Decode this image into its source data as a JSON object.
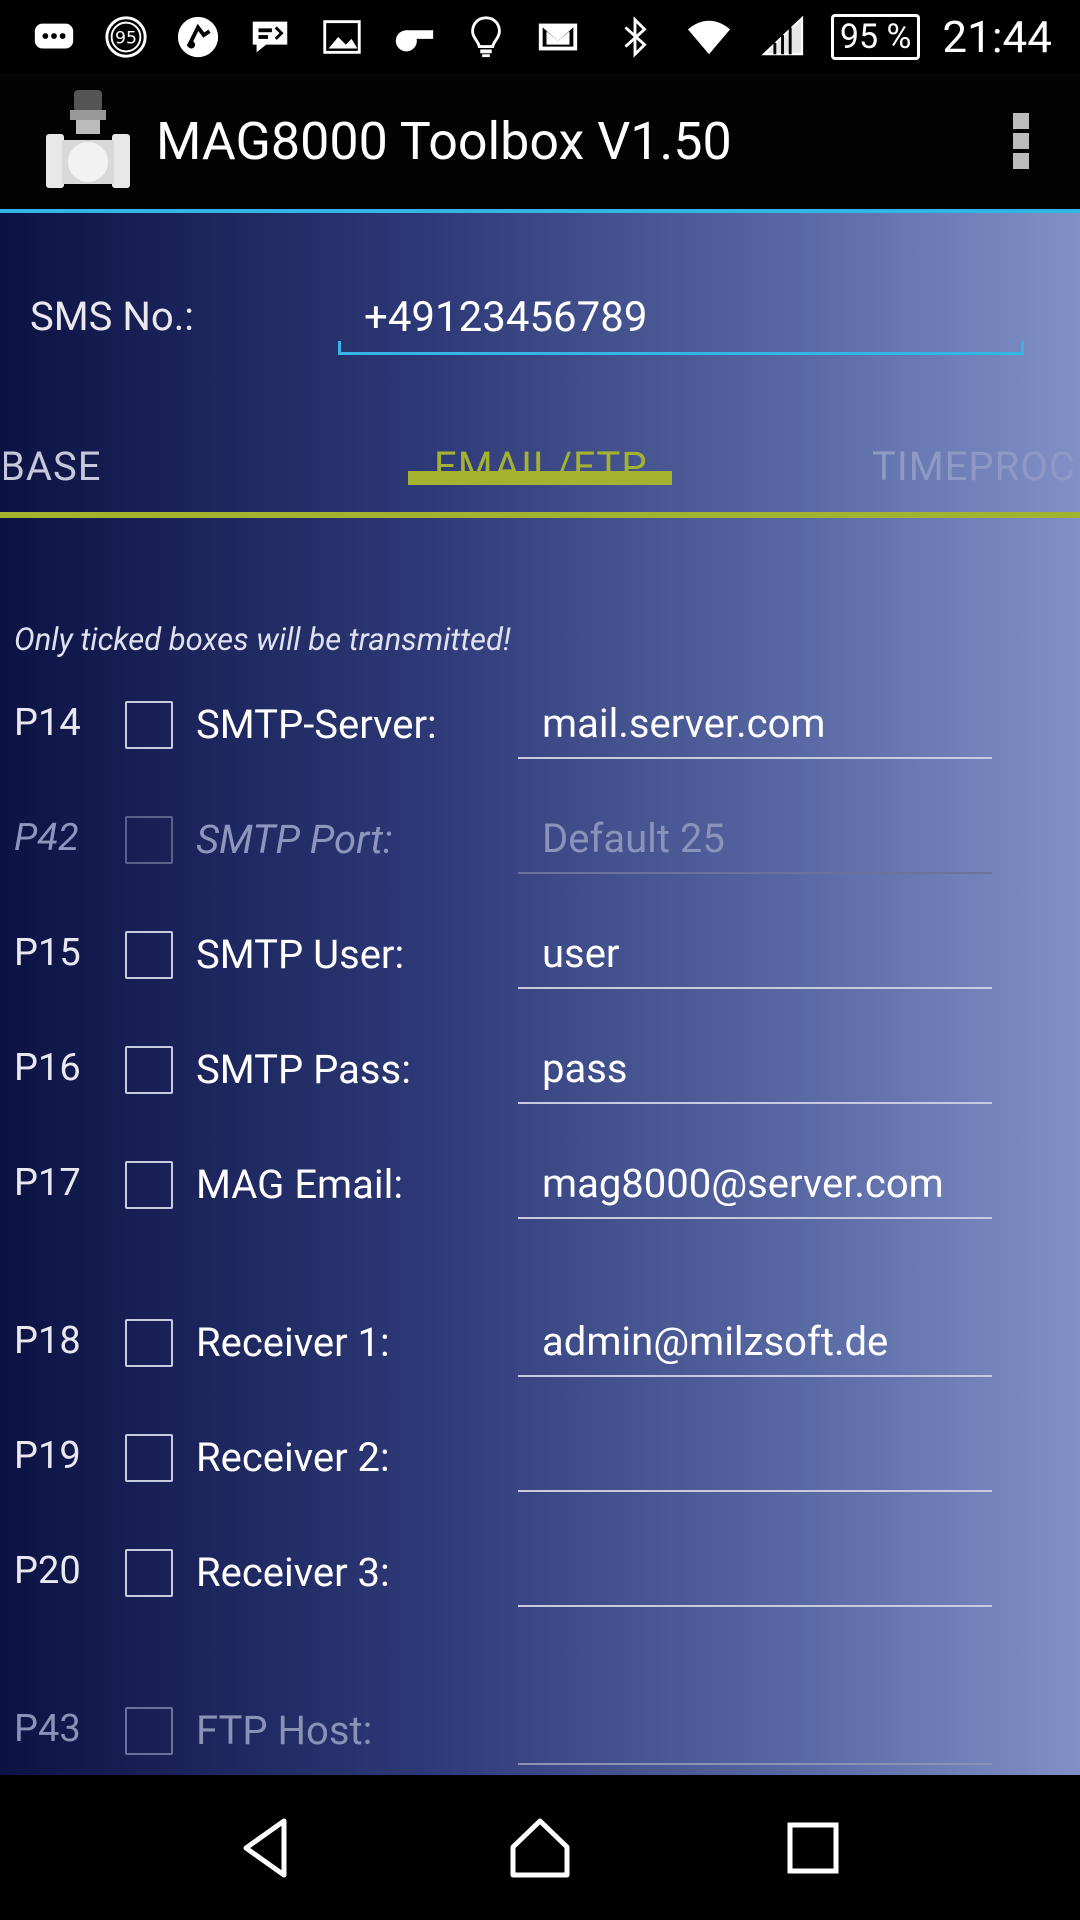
{
  "status_bar": {
    "notification_icons": [
      "messaging-icon",
      "speed-limit-icon",
      "app-icon",
      "chat-icon",
      "gallery-icon",
      "whistle-icon",
      "lightbulb-icon",
      "gmail-icon"
    ],
    "system_icons": [
      "bluetooth-icon",
      "wifi-icon",
      "cell-signal-icon"
    ],
    "battery": "95 %",
    "badge_number": "95",
    "time": "21:44"
  },
  "app_bar": {
    "title": "MAG8000 Toolbox V1.50"
  },
  "sms": {
    "label": "SMS No.:",
    "value": "+49123456789"
  },
  "tabs": [
    {
      "label": "BASE"
    },
    {
      "label": "EMAIL/FTP",
      "selected": true
    },
    {
      "label": "TIMEPROC"
    }
  ],
  "hint": "Only ticked boxes will be transmitted!",
  "params": [
    {
      "code": "P14",
      "label": "SMTP-Server:",
      "value": "mail.server.com",
      "placeholder": ""
    },
    {
      "code": "P42",
      "label": "SMTP Port:",
      "value": "",
      "placeholder": "Default 25"
    },
    {
      "code": "P15",
      "label": "SMTP User:",
      "value": "user",
      "placeholder": ""
    },
    {
      "code": "P16",
      "label": "SMTP Pass:",
      "value": "pass",
      "placeholder": ""
    },
    {
      "code": "P17",
      "label": "MAG Email:",
      "value": "mag8000@server.com",
      "placeholder": ""
    },
    {
      "code": "P18",
      "label": "Receiver 1:",
      "value": "admin@milzsoft.de",
      "placeholder": ""
    },
    {
      "code": "P19",
      "label": "Receiver 2:",
      "value": "",
      "placeholder": ""
    },
    {
      "code": "P20",
      "label": "Receiver 3:",
      "value": "",
      "placeholder": ""
    },
    {
      "code": "P43",
      "label": "FTP Host:",
      "value": "",
      "placeholder": ""
    }
  ],
  "colors": {
    "accent_blue": "#33b5e5",
    "tab_green": "#a4b32f"
  },
  "nav_bar": [
    "back-icon",
    "home-icon",
    "recents-icon"
  ]
}
